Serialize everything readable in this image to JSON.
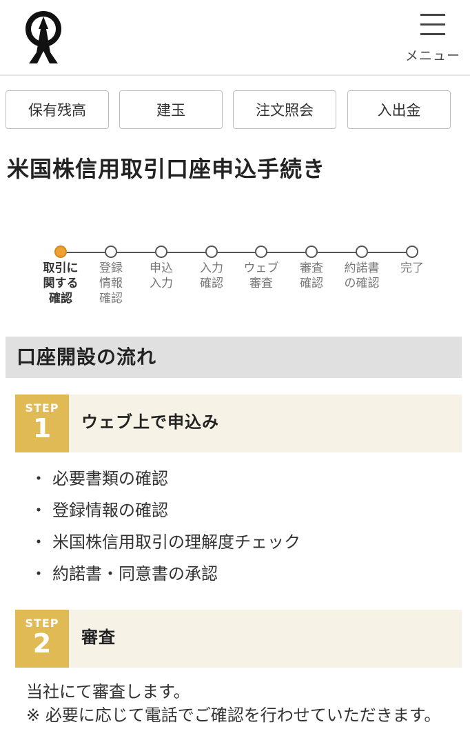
{
  "header": {
    "logo": "company-logo",
    "menu_label": "メニュー"
  },
  "subnav": [
    {
      "label": "保有残高"
    },
    {
      "label": "建玉"
    },
    {
      "label": "注文照会"
    },
    {
      "label": "入出金"
    }
  ],
  "page_title": "米国株信用取引口座申込手続き",
  "stepper": {
    "active_index": 0,
    "steps": [
      {
        "label": "取引に\n関する\n確認"
      },
      {
        "label": "登録\n情報\n確認"
      },
      {
        "label": "申込\n入力"
      },
      {
        "label": "入力\n確認"
      },
      {
        "label": "ウェブ\n審査"
      },
      {
        "label": "審査\n確認"
      },
      {
        "label": "約諾書\nの確認"
      },
      {
        "label": "完了"
      }
    ]
  },
  "section": {
    "title": "口座開設の流れ"
  },
  "steps": [
    {
      "badge_word": "STEP",
      "number": "1",
      "title": "ウェブ上で申込み",
      "items": [
        "必要書類の確認",
        "登録情報の確認",
        "米国株信用取引の理解度チェック",
        "約諾書・同意書の承認"
      ],
      "bullet": "・"
    },
    {
      "badge_word": "STEP",
      "number": "2",
      "title": "審査",
      "text_line1": "当社にて審査します。",
      "text_line2": "※ 必要に応じて電話でご確認を行わせていただきます。"
    }
  ]
}
